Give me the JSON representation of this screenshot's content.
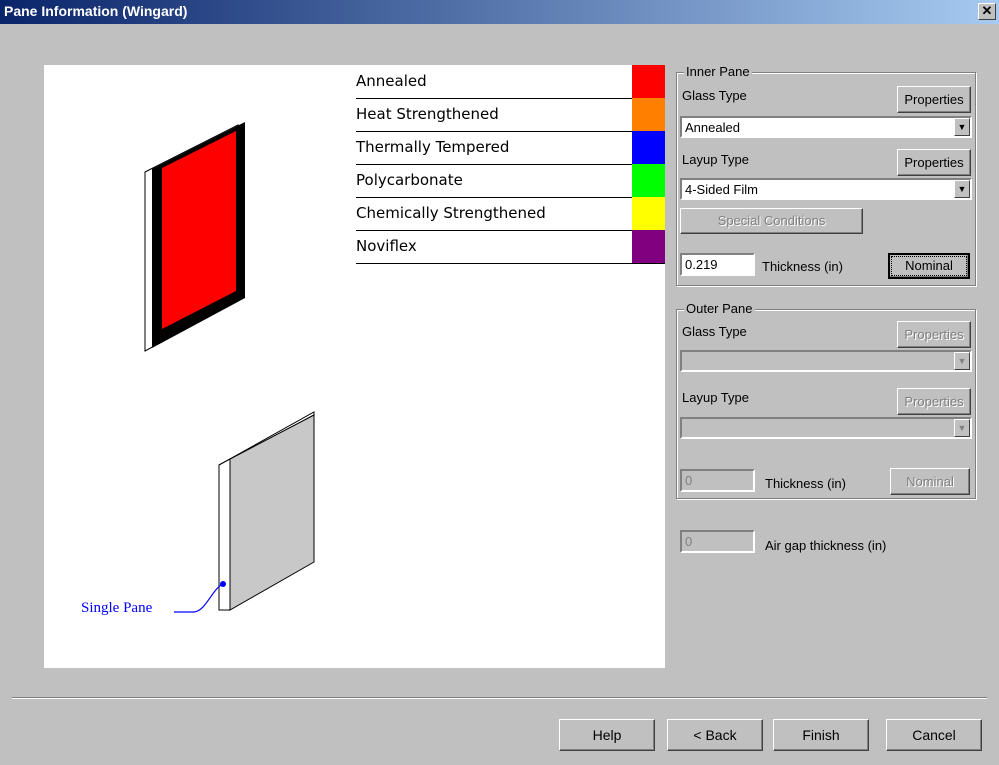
{
  "window": {
    "title": "Pane Information (Wingard)",
    "close_glyph": "✕"
  },
  "legend": [
    {
      "label": "Annealed",
      "color": "#ff0000"
    },
    {
      "label": "Heat Strengthened",
      "color": "#ff8000"
    },
    {
      "label": "Thermally Tempered",
      "color": "#0000ff"
    },
    {
      "label": "Polycarbonate",
      "color": "#00ff00"
    },
    {
      "label": "Chemically Strengthened",
      "color": "#ffff00"
    },
    {
      "label": "Noviflex",
      "color": "#800080"
    }
  ],
  "diagram": {
    "single_pane_label": "Single Pane"
  },
  "inner_pane": {
    "title": "Inner Pane",
    "glass_type_label": "Glass Type",
    "glass_properties_button": "Properties",
    "glass_type_value": "Annealed",
    "layup_type_label": "Layup Type",
    "layup_properties_button": "Properties",
    "layup_type_value": "4-Sided Film",
    "special_conditions_button": "Special Conditions",
    "thickness_value": "0.219",
    "thickness_label": "Thickness (in)",
    "nominal_button": "Nominal"
  },
  "outer_pane": {
    "title": "Outer Pane",
    "glass_type_label": "Glass Type",
    "glass_properties_button": "Properties",
    "glass_type_value": "",
    "layup_type_label": "Layup Type",
    "layup_properties_button": "Properties",
    "layup_type_value": "",
    "thickness_value": "0",
    "thickness_label": "Thickness (in)",
    "nominal_button": "Nominal"
  },
  "air_gap": {
    "value": "0",
    "label": "Air gap thickness (in)"
  },
  "footer": {
    "help": "Help",
    "back": "< Back",
    "finish": "Finish",
    "cancel": "Cancel"
  }
}
